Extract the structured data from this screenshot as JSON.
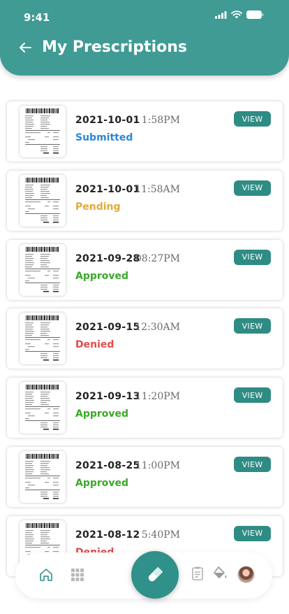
{
  "status_bar": {
    "time": "9:41"
  },
  "header": {
    "title": "My Prescriptions"
  },
  "colors": {
    "header": "#3f9b94",
    "view_button": "#2f8c84",
    "submitted": "#2b87d6",
    "pending": "#e2a93b",
    "approved": "#3aa928",
    "denied": "#e34b4b"
  },
  "prescriptions": [
    {
      "date": "2021-10-01",
      "time": "1:58PM",
      "status": "Submitted",
      "button": "VIEW"
    },
    {
      "date": "2021-10-01",
      "time": "11:58AM",
      "status": "Pending",
      "button": "VIEW"
    },
    {
      "date": "2021-09-28",
      "time": "08:27PM",
      "status": "Approved",
      "button": "VIEW"
    },
    {
      "date": "2021-09-15",
      "time": "12:30AM",
      "status": "Denied",
      "button": "VIEW"
    },
    {
      "date": "2021-09-13",
      "time": "11:20PM",
      "status": "Approved",
      "button": "VIEW"
    },
    {
      "date": "2021-08-25",
      "time": "11:00PM",
      "status": "Approved",
      "button": "VIEW"
    },
    {
      "date": "2021-08-12",
      "time": "5:40PM",
      "status": "Denied",
      "button": "VIEW"
    }
  ],
  "bottom_nav": {
    "items": [
      "home-icon",
      "grid-icon",
      "pill-icon",
      "clipboard-icon",
      "paint-bucket-icon",
      "avatar"
    ]
  }
}
